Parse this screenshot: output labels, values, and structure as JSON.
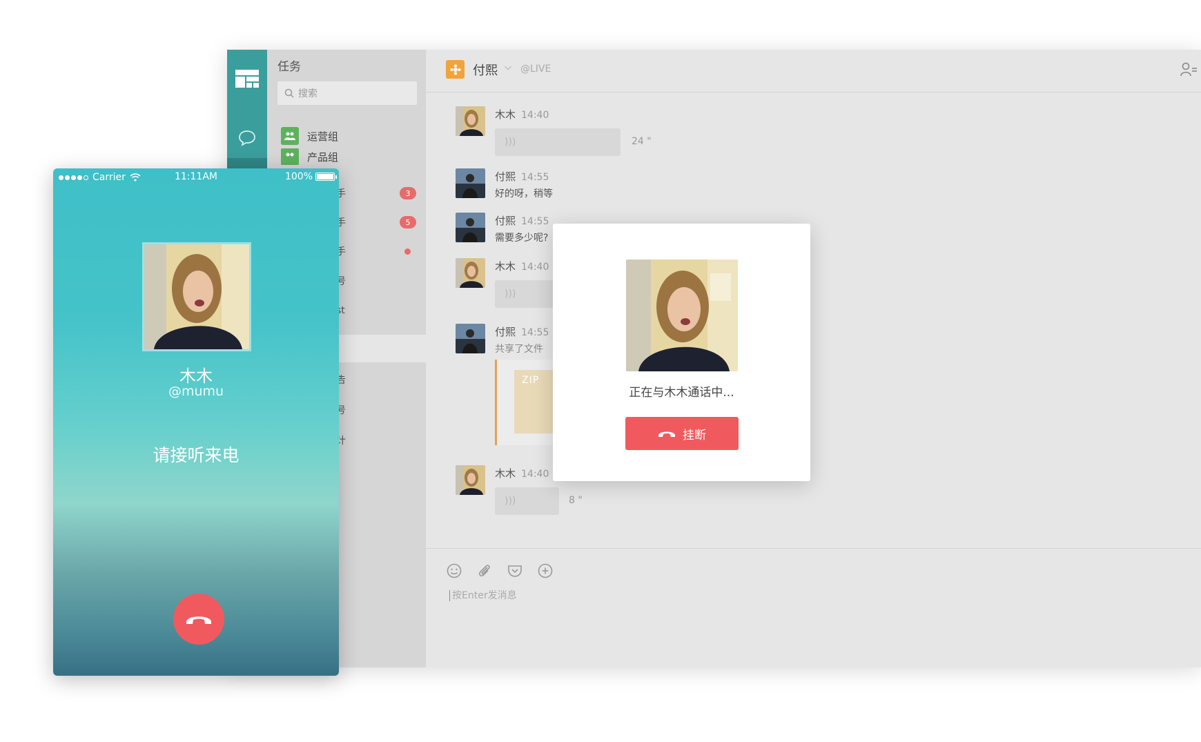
{
  "desktop": {
    "sidebar": {
      "title": "任务",
      "search_placeholder": "搜索",
      "items": [
        {
          "label": "运营组"
        },
        {
          "label": "产品组"
        },
        {
          "label": "手",
          "badge": "3"
        },
        {
          "label": "手",
          "badge": "5"
        },
        {
          "label": "手"
        },
        {
          "label": "号"
        },
        {
          "label": "st"
        },
        {
          "label": "告"
        },
        {
          "label": "号"
        },
        {
          "label": "计"
        }
      ]
    },
    "chat": {
      "contact_name": "付熙",
      "handle": "@LIVE",
      "messages": [
        {
          "sender": "木木",
          "time": "14:40",
          "duration": "24 \""
        },
        {
          "sender": "付熙",
          "time": "14:55",
          "text": "好的呀，稍等"
        },
        {
          "sender": "付熙",
          "time": "14:55",
          "text": "需要多少呢?"
        },
        {
          "sender": "木木",
          "time": "14:40"
        },
        {
          "sender": "付熙",
          "time": "14:55",
          "text": "共享了文件",
          "file_type": "ZIP"
        },
        {
          "sender": "木木",
          "time": "14:40",
          "duration": "8 \""
        }
      ],
      "input_placeholder": "按Enter发消息"
    }
  },
  "call_dialog": {
    "status": "正在与木木通话中...",
    "hangup_label": "挂断",
    "hangup_color": "#f05a5f"
  },
  "phone": {
    "carrier": "Carrier",
    "time": "11:11AM",
    "battery": "100%",
    "battery_level": 1.0,
    "caller_name": "木木",
    "caller_handle": "@mumu",
    "prompt": "请接听来电"
  },
  "colors": {
    "accent_teal": "#3a9e9d",
    "hangup_red": "#f05a5f",
    "group_green": "#5db25d",
    "badge_red": "#e96a6a"
  }
}
